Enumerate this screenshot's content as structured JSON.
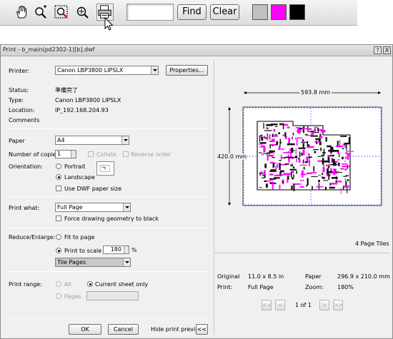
{
  "toolbar": {
    "icons": [
      "pan-hand-icon",
      "zoom-in-icon",
      "zoom-window-icon",
      "zoom-fit-icon",
      "print-icon"
    ],
    "find_value": "",
    "find_label": "Find",
    "clear_label": "Clear",
    "swatches": [
      "#c0c0c0",
      "#ff00ff",
      "#000000"
    ]
  },
  "dialog": {
    "title": "Print - b_main(pd2302-1)[b].dwf",
    "help_label": "?",
    "close_label": "X",
    "printer_label": "Printer:",
    "printer_value": "Canon LBP3800 LIPSLX",
    "properties_label": "Properties...",
    "status_label": "Status:",
    "status_value": "準備完了",
    "type_label": "Type:",
    "type_value": "Canon LBP3800 LIPSLX",
    "location_label": "Location:",
    "location_value": "IP_192.168.204.93",
    "comments_label": "Comments",
    "paper_label": "Paper",
    "paper_value": "A4",
    "copies_label": "Number of copies:",
    "copies_value": "1",
    "collate_label": "Collate",
    "reverse_label": "Reverse order",
    "orientation_label": "Orientation:",
    "portrait_label": "Portrait",
    "landscape_label": "Landscape",
    "use_dwf_label": "Use DWF paper size",
    "print_what_label": "Print what:",
    "print_what_value": "Full Page",
    "force_black_label": "Force drawing geometry to black",
    "reduce_label": "Reduce/Enlarge:",
    "fit_label": "Fit to page",
    "scale_label": "Print to scale",
    "scale_value": "180",
    "percent": "%",
    "tile_value": "Tile Pages",
    "range_label": "Print range:",
    "all_label": "All",
    "current_label": "Current sheet only",
    "pages_label": "Pages",
    "pages_value": "",
    "ok_label": "OK",
    "cancel_label": "Cancel",
    "hide_preview_label": "Hide print preview",
    "collapse_label": "<<"
  },
  "preview": {
    "width_dim": "593.8 mm",
    "height_dim": "420.0 mm",
    "tiles_label": "4 Page Tiles",
    "original_label": "Original",
    "original_value": "11.0 x 8.5 in",
    "paper_label": "Paper",
    "paper_value": "296.9 x 210.0 mm",
    "print_label": "Print:",
    "print_value": "Full Page",
    "zoom_label": "Zoom:",
    "zoom_value": "180%",
    "first_label": "<<",
    "prev_label": "<",
    "page_info": "1 of 1",
    "next_label": ">",
    "last_label": ">>",
    "accent_color": "#ff00ff"
  }
}
